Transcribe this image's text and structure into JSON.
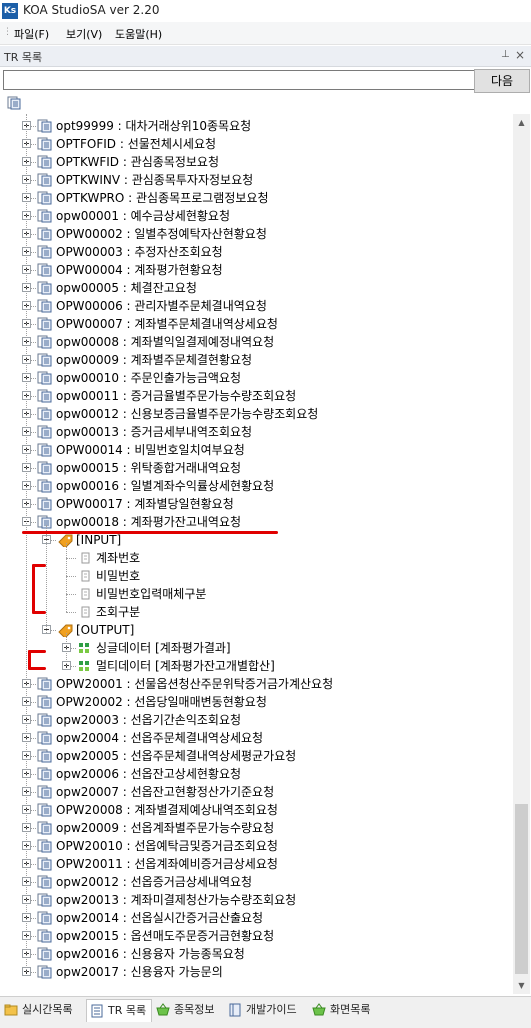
{
  "window": {
    "title": "KOA StudioSA ver 2.20",
    "icon_text": "Ks"
  },
  "menu": {
    "items": [
      "파일(F)",
      "보기(V)",
      "도움말(H)"
    ]
  },
  "panel": {
    "title": "TR 목록",
    "pin_icon": "pin-icon",
    "close_icon": "close-icon"
  },
  "search": {
    "value": "",
    "placeholder": "",
    "button": "다음"
  },
  "tree": [
    {
      "label": "opt99999 : 대차거래상위10종목요청",
      "level": 0,
      "expander": "plus",
      "icon": "tr-icon"
    },
    {
      "label": "OPTFOFID : 선물전체시세요청",
      "level": 0,
      "expander": "plus",
      "icon": "tr-icon"
    },
    {
      "label": "OPTKWFID : 관심종목정보요청",
      "level": 0,
      "expander": "plus",
      "icon": "tr-icon"
    },
    {
      "label": "OPTKWINV : 관심종목투자자정보요청",
      "level": 0,
      "expander": "plus",
      "icon": "tr-icon"
    },
    {
      "label": "OPTKWPRO : 관심종목프로그램정보요청",
      "level": 0,
      "expander": "plus",
      "icon": "tr-icon"
    },
    {
      "label": "opw00001 : 예수금상세현황요청",
      "level": 0,
      "expander": "plus",
      "icon": "tr-icon"
    },
    {
      "label": "OPW00002 : 일별추정예탁자산현황요청",
      "level": 0,
      "expander": "plus",
      "icon": "tr-icon"
    },
    {
      "label": "OPW00003 : 추정자산조회요청",
      "level": 0,
      "expander": "plus",
      "icon": "tr-icon"
    },
    {
      "label": "OPW00004 : 계좌평가현황요청",
      "level": 0,
      "expander": "plus",
      "icon": "tr-icon"
    },
    {
      "label": "opw00005 : 체결잔고요청",
      "level": 0,
      "expander": "plus",
      "icon": "tr-icon"
    },
    {
      "label": "OPW00006 : 관리자별주문체결내역요청",
      "level": 0,
      "expander": "plus",
      "icon": "tr-icon"
    },
    {
      "label": "OPW00007 : 계좌별주문체결내역상세요청",
      "level": 0,
      "expander": "plus",
      "icon": "tr-icon"
    },
    {
      "label": "opw00008 : 계좌별익일결제예정내역요청",
      "level": 0,
      "expander": "plus",
      "icon": "tr-icon"
    },
    {
      "label": "opw00009 : 계좌별주문체결현황요청",
      "level": 0,
      "expander": "plus",
      "icon": "tr-icon"
    },
    {
      "label": "opw00010 : 주문인출가능금액요청",
      "level": 0,
      "expander": "plus",
      "icon": "tr-icon"
    },
    {
      "label": "opw00011 : 증거금율별주문가능수량조회요청",
      "level": 0,
      "expander": "plus",
      "icon": "tr-icon"
    },
    {
      "label": "opw00012 : 신용보증금율별주문가능수량조회요청",
      "level": 0,
      "expander": "plus",
      "icon": "tr-icon"
    },
    {
      "label": "opw00013 : 증거금세부내역조회요청",
      "level": 0,
      "expander": "plus",
      "icon": "tr-icon"
    },
    {
      "label": "OPW00014 : 비밀번호일치여부요청",
      "level": 0,
      "expander": "plus",
      "icon": "tr-icon"
    },
    {
      "label": "opw00015 : 위탁종합거래내역요청",
      "level": 0,
      "expander": "plus",
      "icon": "tr-icon"
    },
    {
      "label": "opw00016 : 일별계좌수익률상세현황요청",
      "level": 0,
      "expander": "plus",
      "icon": "tr-icon"
    },
    {
      "label": "OPW00017 : 계좌별당일현황요청",
      "level": 0,
      "expander": "plus",
      "icon": "tr-icon"
    },
    {
      "label": "opw00018 : 계좌평가잔고내역요청",
      "level": 0,
      "expander": "minus",
      "icon": "tr-icon"
    },
    {
      "label": "[INPUT]",
      "level": 1,
      "expander": "minus",
      "icon": "tag-icon"
    },
    {
      "label": "계좌번호",
      "level": 2,
      "expander": "none",
      "icon": "field-icon"
    },
    {
      "label": "비밀번호",
      "level": 2,
      "expander": "none",
      "icon": "field-icon"
    },
    {
      "label": "비밀번호입력매체구분",
      "level": 2,
      "expander": "none",
      "icon": "field-icon"
    },
    {
      "label": "조회구분",
      "level": 2,
      "expander": "none",
      "icon": "field-icon"
    },
    {
      "label": "[OUTPUT]",
      "level": 1,
      "expander": "minus",
      "icon": "tag-icon"
    },
    {
      "label": "싱글데이터 [계좌평가결과]",
      "level": 2,
      "expander": "plus",
      "icon": "grid-icon"
    },
    {
      "label": "멀티데이터 [계좌평가잔고개별합산]",
      "level": 2,
      "expander": "plus",
      "icon": "grid-icon"
    },
    {
      "label": "OPW20001 : 선물옵션청산주문위탁증거금가계산요청",
      "level": 0,
      "expander": "plus",
      "icon": "tr-icon"
    },
    {
      "label": "OPW20002 : 선옵당일매매변동현황요청",
      "level": 0,
      "expander": "plus",
      "icon": "tr-icon"
    },
    {
      "label": "opw20003 : 선옵기간손익조회요청",
      "level": 0,
      "expander": "plus",
      "icon": "tr-icon"
    },
    {
      "label": "opw20004 : 선옵주문체결내역상세요청",
      "level": 0,
      "expander": "plus",
      "icon": "tr-icon"
    },
    {
      "label": "opw20005 : 선옵주문체결내역상세평균가요청",
      "level": 0,
      "expander": "plus",
      "icon": "tr-icon"
    },
    {
      "label": "opw20006 : 선옵잔고상세현황요청",
      "level": 0,
      "expander": "plus",
      "icon": "tr-icon"
    },
    {
      "label": "opw20007 : 선옵잔고현황정산가기준요청",
      "level": 0,
      "expander": "plus",
      "icon": "tr-icon"
    },
    {
      "label": "OPW20008 : 계좌별결제예상내역조회요청",
      "level": 0,
      "expander": "plus",
      "icon": "tr-icon"
    },
    {
      "label": "opw20009 : 선옵계좌별주문가능수량요청",
      "level": 0,
      "expander": "plus",
      "icon": "tr-icon"
    },
    {
      "label": "OPW20010 : 선옵예탁금및증거금조회요청",
      "level": 0,
      "expander": "plus",
      "icon": "tr-icon"
    },
    {
      "label": "OPW20011 : 선옵계좌예비증거금상세요청",
      "level": 0,
      "expander": "plus",
      "icon": "tr-icon"
    },
    {
      "label": "opw20012 : 선옵증거금상세내역요청",
      "level": 0,
      "expander": "plus",
      "icon": "tr-icon"
    },
    {
      "label": "opw20013 : 계좌미결제청산가능수량조회요청",
      "level": 0,
      "expander": "plus",
      "icon": "tr-icon"
    },
    {
      "label": "opw20014 : 선옵실시간증거금산출요청",
      "level": 0,
      "expander": "plus",
      "icon": "tr-icon"
    },
    {
      "label": "opw20015 : 옵션매도주문증거금현황요청",
      "level": 0,
      "expander": "plus",
      "icon": "tr-icon"
    },
    {
      "label": "opw20016 : 신용융자 가능종목요청",
      "level": 0,
      "expander": "plus",
      "icon": "tr-icon"
    },
    {
      "label": "opw20017 : 신용융자 가능문의",
      "level": 0,
      "expander": "plus",
      "icon": "tr-icon"
    }
  ],
  "tabs": [
    {
      "label": "실시간목록",
      "icon": "folder-icon",
      "active": false
    },
    {
      "label": "TR 목록",
      "icon": "document-icon",
      "active": true
    },
    {
      "label": "종목정보",
      "icon": "basket-icon",
      "active": false
    },
    {
      "label": "개발가이드",
      "icon": "book-icon",
      "active": false
    },
    {
      "label": "화면목록",
      "icon": "basket-icon",
      "active": false
    }
  ],
  "colors": {
    "accent": "#1c5fa8",
    "annotation": "#e00000",
    "tag": "#f0a020",
    "grid": "#2f9e44"
  }
}
